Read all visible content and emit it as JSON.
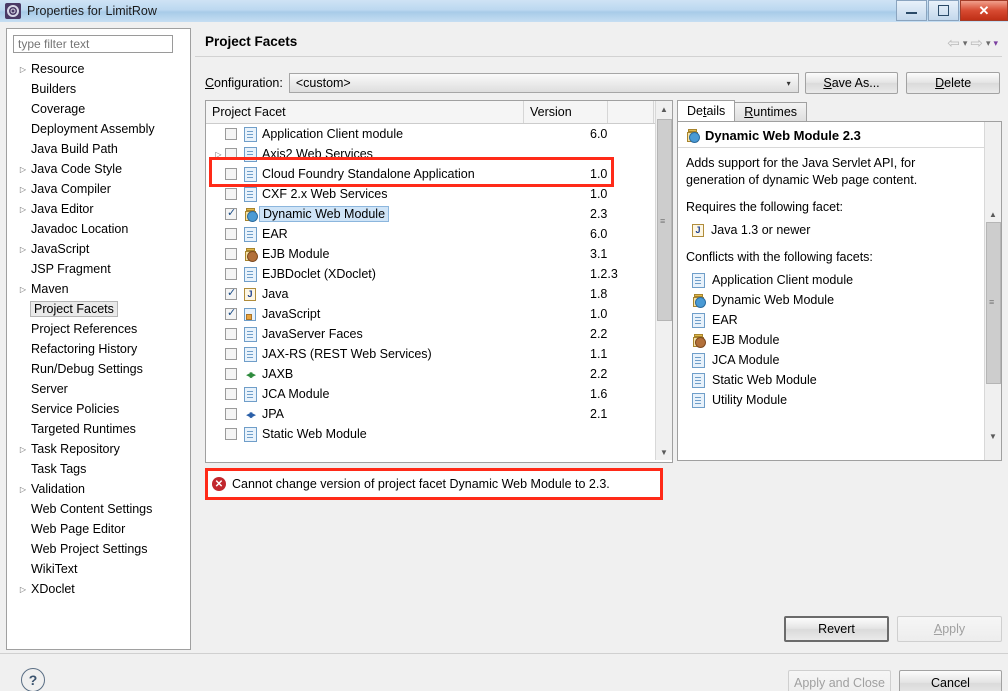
{
  "window": {
    "title": "Properties for LimitRow",
    "icon": "gear-icon",
    "minimize_label": "",
    "maximize_label": "",
    "close_label": "✕"
  },
  "sidebar": {
    "filter_placeholder": "type filter text",
    "filter_value": "",
    "items": [
      {
        "label": "Resource",
        "expandable": true,
        "selected": false
      },
      {
        "label": "Builders",
        "expandable": false,
        "selected": false
      },
      {
        "label": "Coverage",
        "expandable": false,
        "selected": false
      },
      {
        "label": "Deployment Assembly",
        "expandable": false,
        "selected": false
      },
      {
        "label": "Java Build Path",
        "expandable": false,
        "selected": false
      },
      {
        "label": "Java Code Style",
        "expandable": true,
        "selected": false
      },
      {
        "label": "Java Compiler",
        "expandable": true,
        "selected": false
      },
      {
        "label": "Java Editor",
        "expandable": true,
        "selected": false
      },
      {
        "label": "Javadoc Location",
        "expandable": false,
        "selected": false
      },
      {
        "label": "JavaScript",
        "expandable": true,
        "selected": false
      },
      {
        "label": "JSP Fragment",
        "expandable": false,
        "selected": false
      },
      {
        "label": "Maven",
        "expandable": true,
        "selected": false
      },
      {
        "label": "Project Facets",
        "expandable": false,
        "selected": true
      },
      {
        "label": "Project References",
        "expandable": false,
        "selected": false
      },
      {
        "label": "Refactoring History",
        "expandable": false,
        "selected": false
      },
      {
        "label": "Run/Debug Settings",
        "expandable": false,
        "selected": false
      },
      {
        "label": "Server",
        "expandable": false,
        "selected": false
      },
      {
        "label": "Service Policies",
        "expandable": false,
        "selected": false
      },
      {
        "label": "Targeted Runtimes",
        "expandable": false,
        "selected": false
      },
      {
        "label": "Task Repository",
        "expandable": true,
        "selected": false
      },
      {
        "label": "Task Tags",
        "expandable": false,
        "selected": false
      },
      {
        "label": "Validation",
        "expandable": true,
        "selected": false
      },
      {
        "label": "Web Content Settings",
        "expandable": false,
        "selected": false
      },
      {
        "label": "Web Page Editor",
        "expandable": false,
        "selected": false
      },
      {
        "label": "Web Project Settings",
        "expandable": false,
        "selected": false
      },
      {
        "label": "WikiText",
        "expandable": false,
        "selected": false
      },
      {
        "label": "XDoclet",
        "expandable": true,
        "selected": false
      }
    ]
  },
  "main": {
    "page_title": "Project Facets",
    "nav": {
      "back_icon": "arrow-left-icon",
      "back_caret": "▾",
      "forward_icon": "arrow-right-icon",
      "forward_caret": "▾",
      "menu_caret": "▾"
    },
    "configuration": {
      "label": "Configuration:",
      "mnemonic": "C",
      "value": "<custom>",
      "caret": "▾",
      "save_as_label": "Save As...",
      "save_as_mnemonic": "S",
      "delete_label": "Delete",
      "delete_mnemonic": "D"
    },
    "table": {
      "columns": [
        "Project Facet",
        "Version"
      ],
      "rows": [
        {
          "name": "Application Client module",
          "version": "6.0",
          "checked": false,
          "expandable": false,
          "has_caret": true,
          "icon": "document-icon"
        },
        {
          "name": "Axis2 Web Services",
          "version": "",
          "checked": false,
          "expandable": true,
          "has_caret": false,
          "icon": "document-icon"
        },
        {
          "name": "Cloud Foundry Standalone Application",
          "version": "1.0",
          "checked": false,
          "expandable": false,
          "has_caret": false,
          "icon": "document-icon"
        },
        {
          "name": "CXF 2.x Web Services",
          "version": "1.0",
          "checked": false,
          "expandable": false,
          "has_caret": false,
          "icon": "document-icon"
        },
        {
          "name": "Dynamic Web Module",
          "version": "2.3",
          "checked": true,
          "expandable": false,
          "has_caret": true,
          "icon": "web-module-icon",
          "selected": true
        },
        {
          "name": "EAR",
          "version": "6.0",
          "checked": false,
          "expandable": false,
          "has_caret": true,
          "icon": "document-icon"
        },
        {
          "name": "EJB Module",
          "version": "3.1",
          "checked": false,
          "expandable": false,
          "has_caret": true,
          "icon": "ejb-module-icon"
        },
        {
          "name": "EJBDoclet (XDoclet)",
          "version": "1.2.3",
          "checked": false,
          "expandable": false,
          "has_caret": true,
          "icon": "document-icon"
        },
        {
          "name": "Java",
          "version": "1.8",
          "checked": true,
          "expandable": false,
          "has_caret": true,
          "icon": "java-icon"
        },
        {
          "name": "JavaScript",
          "version": "1.0",
          "checked": true,
          "expandable": false,
          "has_caret": false,
          "icon": "javascript-icon"
        },
        {
          "name": "JavaServer Faces",
          "version": "2.2",
          "checked": false,
          "expandable": false,
          "has_caret": true,
          "icon": "document-icon"
        },
        {
          "name": "JAX-RS (REST Web Services)",
          "version": "1.1",
          "checked": false,
          "expandable": false,
          "has_caret": true,
          "icon": "document-icon"
        },
        {
          "name": "JAXB",
          "version": "2.2",
          "checked": false,
          "expandable": false,
          "has_caret": true,
          "icon": "jaxb-icon"
        },
        {
          "name": "JCA Module",
          "version": "1.6",
          "checked": false,
          "expandable": false,
          "has_caret": true,
          "icon": "document-icon"
        },
        {
          "name": "JPA",
          "version": "2.1",
          "checked": false,
          "expandable": false,
          "has_caret": true,
          "icon": "jpa-icon"
        },
        {
          "name": "Static Web Module",
          "version": "",
          "checked": false,
          "expandable": false,
          "has_caret": false,
          "icon": "document-icon"
        }
      ]
    },
    "details": {
      "tabs": [
        {
          "label": "Details",
          "mnemonic": "t",
          "active": true
        },
        {
          "label": "Runtimes",
          "mnemonic": "R",
          "active": false
        }
      ],
      "header": "Dynamic Web Module 2.3",
      "header_icon": "web-module-icon",
      "description": "Adds support for the Java Servlet API, for generation of dynamic Web page content.",
      "requires_label": "Requires the following facet:",
      "requires": [
        {
          "label": "Java 1.3 or newer",
          "icon": "java-icon"
        }
      ],
      "conflicts_label": "Conflicts with the following facets:",
      "conflicts": [
        {
          "label": "Application Client module",
          "icon": "document-icon"
        },
        {
          "label": "Dynamic Web Module",
          "icon": "web-module-icon"
        },
        {
          "label": "EAR",
          "icon": "document-icon"
        },
        {
          "label": "EJB Module",
          "icon": "ejb-module-icon"
        },
        {
          "label": "JCA Module",
          "icon": "document-icon"
        },
        {
          "label": "Static Web Module",
          "icon": "document-icon"
        },
        {
          "label": "Utility Module",
          "icon": "document-icon"
        }
      ]
    },
    "error": {
      "icon": "error-icon",
      "message": "Cannot change version of project facet Dynamic Web Module to 2.3."
    }
  },
  "footer": {
    "revert_label": "Revert",
    "apply_label": "Apply",
    "apply_enabled": false,
    "apply_and_close_label": "Apply and Close",
    "apply_and_close_enabled": false,
    "cancel_label": "Cancel",
    "help_label": "?"
  },
  "colors": {
    "annotation_red": "#ff2a18",
    "error_red": "#c1272d",
    "selection_blue": "#cfe4f7",
    "title_gradient_top": "#cfe3f5"
  }
}
